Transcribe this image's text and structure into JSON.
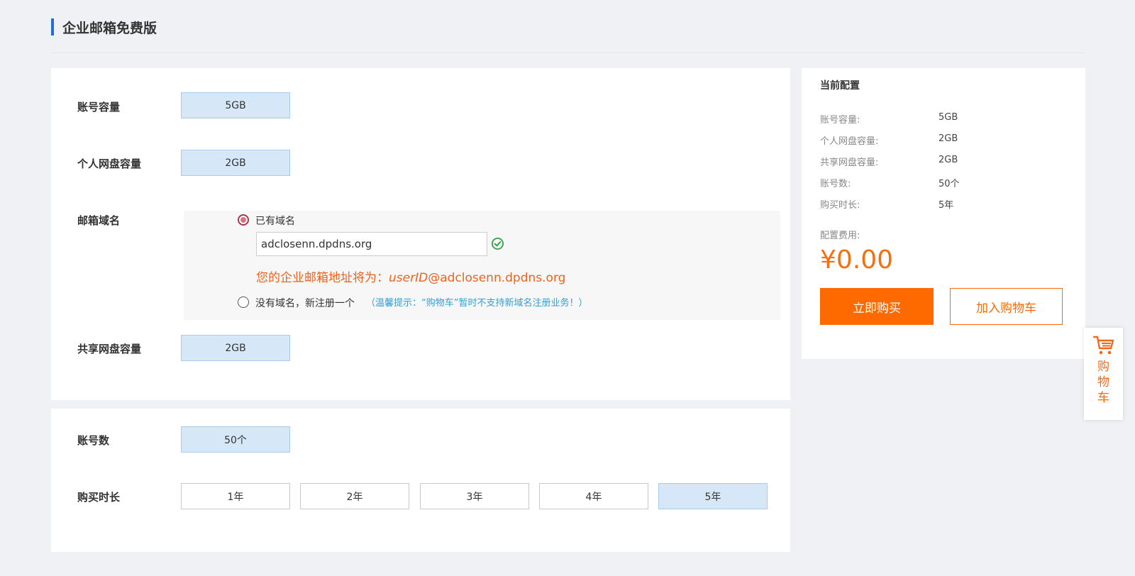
{
  "page": {
    "title": "企业邮箱免费版"
  },
  "config": {
    "capacity": {
      "label": "账号容量",
      "value": "5GB"
    },
    "personal_disk": {
      "label": "个人网盘容量",
      "value": "2GB"
    },
    "domain": {
      "label": "邮箱域名",
      "option_existing": "已有域名",
      "input_value": "adclosenn.dpdns.org",
      "address_prefix": "您的企业邮箱地址将为：",
      "address_user": "userID",
      "address_domain": "@adclosenn.dpdns.org",
      "option_new": "没有域名，新注册一个",
      "hint": "（温馨提示：“购物车”暂时不支持新域名注册业务！）"
    },
    "shared_disk": {
      "label": "共享网盘容量",
      "value": "2GB"
    },
    "accounts": {
      "label": "账号数",
      "value": "50个"
    },
    "duration": {
      "label": "购买时长",
      "options": [
        "1年",
        "2年",
        "3年",
        "4年",
        "5年"
      ],
      "selected": "5年"
    }
  },
  "summary": {
    "title": "当前配置",
    "rows": [
      {
        "key": "账号容量:",
        "value": "5GB"
      },
      {
        "key": "个人网盘容量:",
        "value": "2GB"
      },
      {
        "key": "共享网盘容量:",
        "value": "2GB"
      },
      {
        "key": "账号数:",
        "value": "50个"
      },
      {
        "key": "购买时长:",
        "value": "5年"
      }
    ],
    "fee_label": "配置费用:",
    "price": "¥0.00",
    "buy_label": "立即购买",
    "cart_label": "加入购物车"
  },
  "float_cart": {
    "label": "购物车",
    "icon": "cart-icon"
  },
  "colors": {
    "accent": "#ff6a00",
    "selected_bg": "#d6e8f7",
    "brand_bar": "#1e6fd9",
    "hint": "#2f9fd8"
  }
}
